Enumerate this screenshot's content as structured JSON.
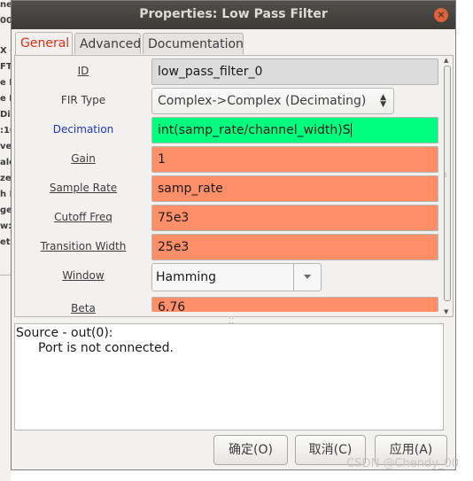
{
  "background_window": {
    "fragments": [
      "ne",
      "00",
      "X G",
      "FT",
      "e R",
      "e F",
      "Div:",
      ":10",
      "ve",
      "ale",
      "ze:",
      "h F",
      "ge /",
      "w:",
      "et W"
    ]
  },
  "window": {
    "title": "Properties: Low Pass Filter",
    "close_glyph": "×"
  },
  "tabs": [
    {
      "label": "General",
      "active": true
    },
    {
      "label": "Advanced",
      "active": false
    },
    {
      "label": "Documentation",
      "active": false
    }
  ],
  "params": {
    "id": {
      "label": "ID",
      "value": "low_pass_filter_0"
    },
    "fir_type": {
      "label": "FIR Type",
      "value": "Complex->Complex (Decimating)"
    },
    "decimation": {
      "label": "Decimation",
      "value": "int(samp_rate/channel_width)S"
    },
    "gain": {
      "label": "Gain",
      "value": "1"
    },
    "sample_rate": {
      "label": "Sample Rate",
      "value": "samp_rate"
    },
    "cutoff_freq": {
      "label": "Cutoff Freq",
      "value": "75e3"
    },
    "transition_width": {
      "label": "Transition Width",
      "value": "25e3"
    },
    "window": {
      "label": "Window",
      "value": "Hamming"
    },
    "beta": {
      "label": "Beta",
      "value": "6.76"
    }
  },
  "console": {
    "line1": "Source - out(0):",
    "line2": "Port is not connected."
  },
  "buttons": {
    "ok": "确定(O)",
    "cancel": "取消(C)",
    "apply": "应用(A)"
  },
  "watermark": "CSDN @Chendy_00",
  "colors": {
    "titlebar": "#3c3b37",
    "active_tab_text": "#e22e13",
    "field_ok": "#01ff7f",
    "field_default": "#ff8f69",
    "field_readonly": "#dcdcdc",
    "link_label": "#1d36c8"
  }
}
